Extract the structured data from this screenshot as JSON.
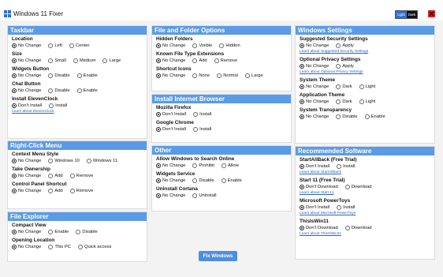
{
  "window": {
    "title": "Windows 11 Fixer",
    "theme_light": "Light",
    "theme_dark": "Dark"
  },
  "colors": {
    "accent": "#5b9be6",
    "button": "#4f8de0",
    "close": "#e01b1b",
    "link": "#2a64c4"
  },
  "taskbar": {
    "title": "Taskbar",
    "location": {
      "label": "Location",
      "options": [
        "No Change",
        "Left",
        "Center"
      ]
    },
    "size": {
      "label": "Size",
      "options": [
        "No Change",
        "Small",
        "Medium",
        "Large"
      ]
    },
    "widgets": {
      "label": "Widgets Button",
      "options": [
        "No Change",
        "Disable",
        "Enable"
      ]
    },
    "chat": {
      "label": "Chat Button",
      "options": [
        "No Change",
        "Disable",
        "Enable"
      ]
    },
    "elevenclock": {
      "label": "Install ElevenClock",
      "options": [
        "Don't Install",
        "Install"
      ],
      "link": "Learn about ElevenClock"
    }
  },
  "rightclick": {
    "title": "Right-Click Menu",
    "context_style": {
      "label": "Context Menu Style",
      "options": [
        "No Change",
        "Windows 10",
        "Windows 11"
      ]
    },
    "ownership": {
      "label": "Take Ownership",
      "options": [
        "No Change",
        "Add",
        "Remove"
      ]
    },
    "control_panel": {
      "label": "Control Panel Shortcut",
      "options": [
        "No Change",
        "Add",
        "Remove"
      ]
    }
  },
  "explorer": {
    "title": "File Explorer",
    "compact": {
      "label": "Compact View",
      "options": [
        "No Change",
        "Enable",
        "Disable"
      ]
    },
    "opening": {
      "label": "Opening Location",
      "options": [
        "No Change",
        "This PC",
        "Quick access"
      ]
    }
  },
  "files": {
    "title": "File and Folder Options",
    "hidden": {
      "label": "Hidden Folders",
      "options": [
        "No Change",
        "Visible",
        "Hidden"
      ]
    },
    "extensions": {
      "label": "Known File Type Extensions",
      "options": [
        "No Change",
        "Add",
        "Remove"
      ]
    },
    "shortcut_icons": {
      "label": "Shortcut Icons",
      "options": [
        "No Change",
        "None",
        "Normal",
        "Large"
      ]
    }
  },
  "browser": {
    "title": "Install Internet Browser",
    "firefox": {
      "label": "Mozilla Firefox",
      "options": [
        "Don't Install",
        "Install"
      ]
    },
    "chrome": {
      "label": "Google Chrome",
      "options": [
        "Don't Install",
        "Install"
      ]
    }
  },
  "other": {
    "title": "Other",
    "search_online": {
      "label": "Allow Windows to Search Online",
      "options": [
        "No Change",
        "Prohibit",
        "Allow"
      ]
    },
    "widgets_service": {
      "label": "Widgets Service",
      "options": [
        "No Change",
        "Disable",
        "Enable"
      ]
    },
    "cortana": {
      "label": "Uninstall Cortana",
      "options": [
        "No Change",
        "Uninstall"
      ]
    }
  },
  "winsettings": {
    "title": "Windows Settings",
    "security": {
      "label": "Suggested Security Settings",
      "options": [
        "No Change",
        "Apply"
      ],
      "link": "Learn about Suggested Security Settings"
    },
    "privacy": {
      "label": "Optional Privacy Settings",
      "options": [
        "No Change",
        "Apply"
      ],
      "link": "Learn about Optional Privacy Settings"
    },
    "system_theme": {
      "label": "System Theme",
      "options": [
        "No Change",
        "Dark",
        "Light"
      ]
    },
    "app_theme": {
      "label": "Application Theme",
      "options": [
        "No Change",
        "Dark",
        "Light"
      ]
    },
    "transparency": {
      "label": "System Transparency",
      "options": [
        "No Change",
        "Disable",
        "Enable"
      ]
    }
  },
  "software": {
    "title": "Recommended Software",
    "startallback": {
      "label": "StartAllBack (Free Trial)",
      "options": [
        "Don't Install",
        "Install"
      ],
      "link": "Learn about StartAllBack"
    },
    "start11": {
      "label": "Start 11 (Free Trial)",
      "options": [
        "Don't Download",
        "Download"
      ],
      "link": "Learn about Start 11"
    },
    "powertoys": {
      "label": "Microsoft PowerToys",
      "options": [
        "Don't Install",
        "Install"
      ],
      "link": "Learn about Microsoft PowerToys"
    },
    "thisiswin11": {
      "label": "ThisIsWin11",
      "options": [
        "Don't Download",
        "Download"
      ],
      "link": "Learn about ThisIsWin11"
    }
  },
  "fix_button": "Fix Windows"
}
